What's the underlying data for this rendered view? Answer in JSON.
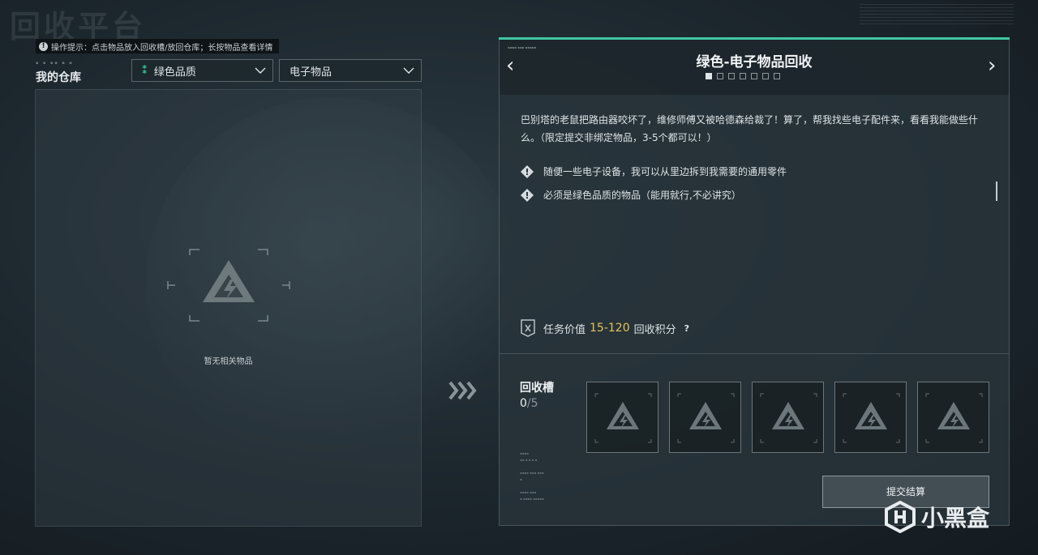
{
  "page": {
    "title": "回收平台"
  },
  "tip": {
    "icon": "info-icon",
    "text": "操作提示：点击物品放入回收槽/放回仓库；长按物品查看详情"
  },
  "warehouse": {
    "title": "我的仓库",
    "quality_filter": {
      "mark": "⁑",
      "value": "绿色品质",
      "mark_color": "#37d39b"
    },
    "category_filter": {
      "value": "电子物品"
    },
    "empty_text": "暂无相关物品"
  },
  "transfer": {
    "icon": "triple-chevron-right-icon"
  },
  "quest": {
    "title": "绿色-电子物品回收",
    "accent_color": "#3ec7a2",
    "pages": {
      "total": 7,
      "current": 1
    },
    "description": "巴别塔的老鼠把路由器咬坏了，维修师傅又被哈德森给裁了！算了，帮我找些电子配件来，看看我能做些什么。（限定提交非绑定物品，3-5个都可以！）",
    "requirements": [
      {
        "icon": "diamond-alert-icon",
        "text": "随便一些电子设备，我可以从里边拆到我需要的通用零件"
      },
      {
        "icon": "diamond-alert-icon",
        "text": "必须是绿色品质的物品（能用就行,不必讲究）"
      }
    ],
    "reward": {
      "label_prefix": "任务价值",
      "value": "15-120",
      "label_suffix": "回收积分",
      "help": "?",
      "value_color": "#e5c25b"
    }
  },
  "recycle_bin": {
    "title": "回收槽",
    "count": "0",
    "separator_max": "/5",
    "slots": [
      {
        "icon": "empty-slot-logo-icon"
      },
      {
        "icon": "empty-slot-logo-icon"
      },
      {
        "icon": "empty-slot-logo-icon"
      },
      {
        "icon": "empty-slot-logo-icon"
      },
      {
        "icon": "empty-slot-logo-icon"
      }
    ],
    "submit_label": "提交结算"
  },
  "watermark": {
    "text": "小黑盒"
  }
}
